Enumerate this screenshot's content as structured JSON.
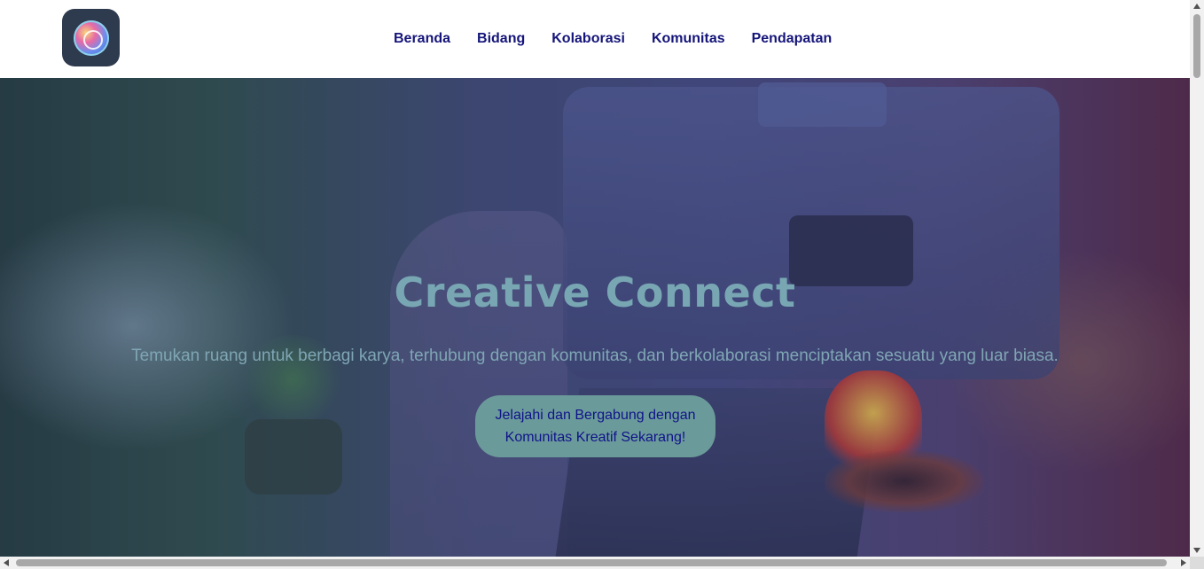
{
  "header": {
    "logo_icon": "creative-connect-logo-icon",
    "nav": [
      {
        "label": "Beranda"
      },
      {
        "label": "Bidang"
      },
      {
        "label": "Kolaborasi"
      },
      {
        "label": "Komunitas"
      },
      {
        "label": "Pendapatan"
      }
    ]
  },
  "hero": {
    "title": "Creative Connect",
    "subtitle": "Temukan ruang untuk berbagi karya, terhubung dengan komunitas, dan berkolaborasi menciptakan sesuatu yang luar biasa.",
    "cta_label": "Jelajahi dan Bergabung dengan Komunitas Kreatif Sekarang!"
  },
  "colors": {
    "nav_text": "#15157a",
    "hero_title": "#78a7b3",
    "cta_background": "#6b9a9a",
    "cta_text": "#10148a"
  }
}
